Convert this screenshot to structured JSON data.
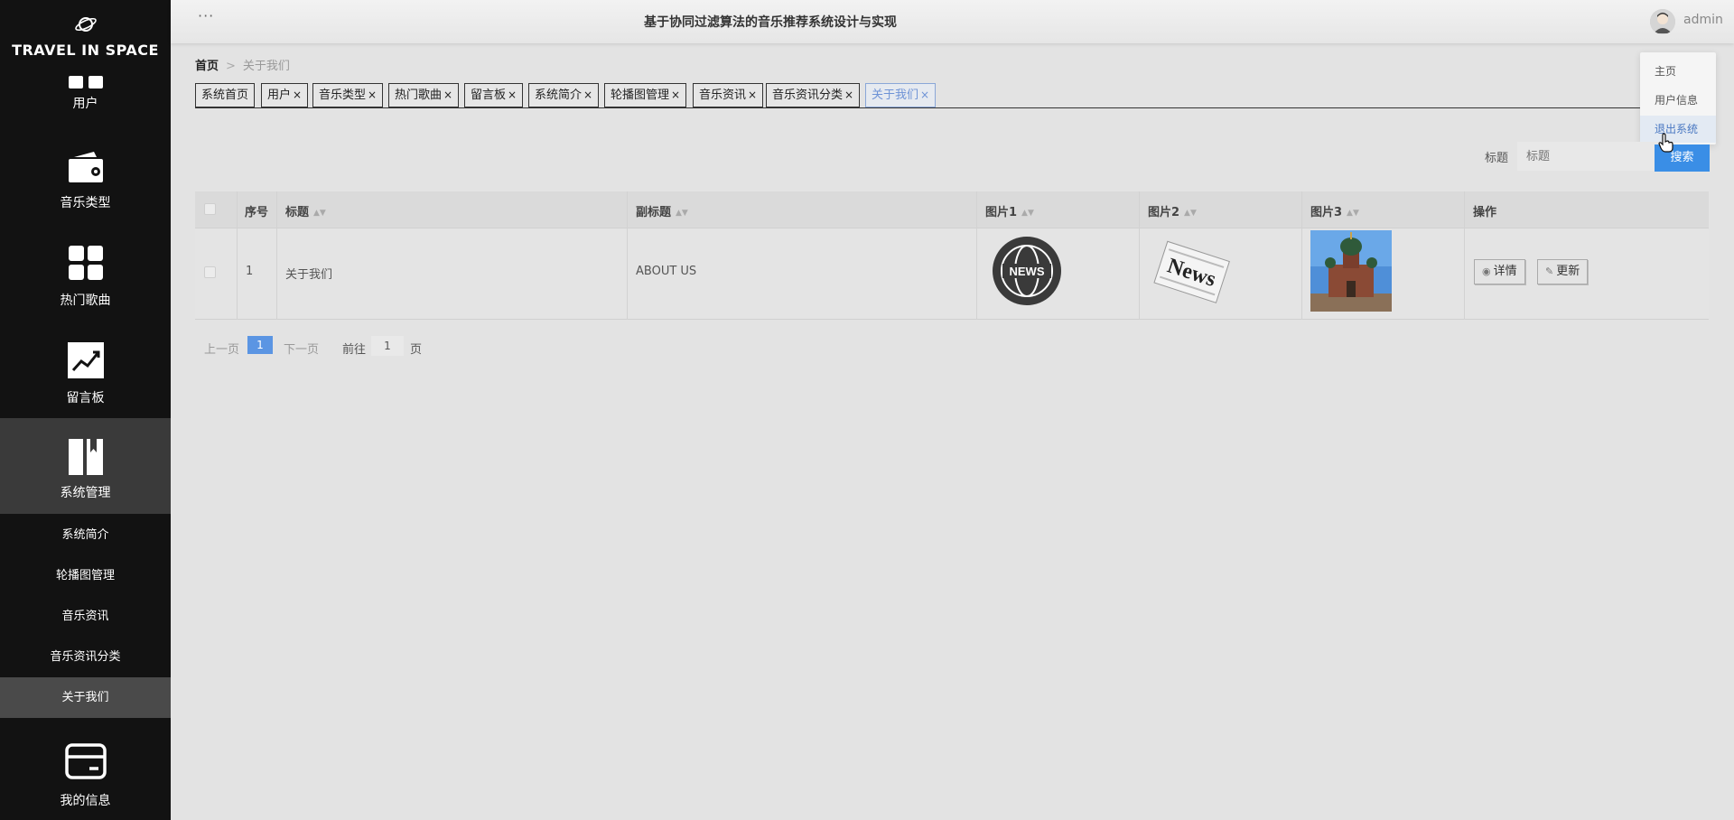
{
  "app": {
    "logo_text": "TRAVEL IN SPACE",
    "system_title": "基于协同过滤算法的音乐推荐系统设计与实现",
    "menu_dots": "···",
    "username": "admin"
  },
  "sidebar": {
    "items": [
      {
        "label": "用户"
      },
      {
        "label": "音乐类型"
      },
      {
        "label": "热门歌曲"
      },
      {
        "label": "留言板"
      },
      {
        "label": "系统管理"
      },
      {
        "label": "我的信息"
      }
    ],
    "sub_items": [
      {
        "label": "系统简介"
      },
      {
        "label": "轮播图管理"
      },
      {
        "label": "音乐资讯"
      },
      {
        "label": "音乐资讯分类"
      },
      {
        "label": "关于我们"
      }
    ]
  },
  "dropdown": {
    "items": [
      {
        "label": "主页"
      },
      {
        "label": "用户信息"
      },
      {
        "label": "退出系统"
      }
    ]
  },
  "breadcrumb": {
    "home": "首页",
    "separator": ">",
    "current": "关于我们"
  },
  "tags": [
    {
      "label": "系统首页",
      "closable": false
    },
    {
      "label": "用户",
      "closable": true
    },
    {
      "label": "音乐类型",
      "closable": true
    },
    {
      "label": "热门歌曲",
      "closable": true
    },
    {
      "label": "留言板",
      "closable": true
    },
    {
      "label": "系统简介",
      "closable": true
    },
    {
      "label": "轮播图管理",
      "closable": true
    },
    {
      "label": "音乐资讯",
      "closable": true
    },
    {
      "label": "音乐资讯分类",
      "closable": true
    },
    {
      "label": "关于我们",
      "closable": true,
      "active": true
    }
  ],
  "tag_close": "×",
  "search": {
    "label": "标题",
    "placeholder": "标题",
    "button_label": "搜索"
  },
  "table": {
    "headers": [
      "序号",
      "标题",
      "副标题",
      "图片1",
      "图片2",
      "图片3",
      "操作"
    ],
    "sort_icon": "▲▼",
    "rows": [
      {
        "index": "1",
        "title": "关于我们",
        "subtitle": "ABOUT US",
        "pic1_text": "NEWS",
        "pic2_text": "News"
      }
    ],
    "actions": {
      "detail_label": "详情",
      "update_label": "更新"
    }
  },
  "pagination": {
    "prev": "上一页",
    "current_page": "1",
    "next": "下一页",
    "goto_label": "前往",
    "goto_value": "1",
    "page_suffix": "页"
  },
  "colors": {
    "sidebar_bg": "#121212",
    "accent_blue": "#3a8ee6",
    "active_tag": "#6e93d6"
  }
}
